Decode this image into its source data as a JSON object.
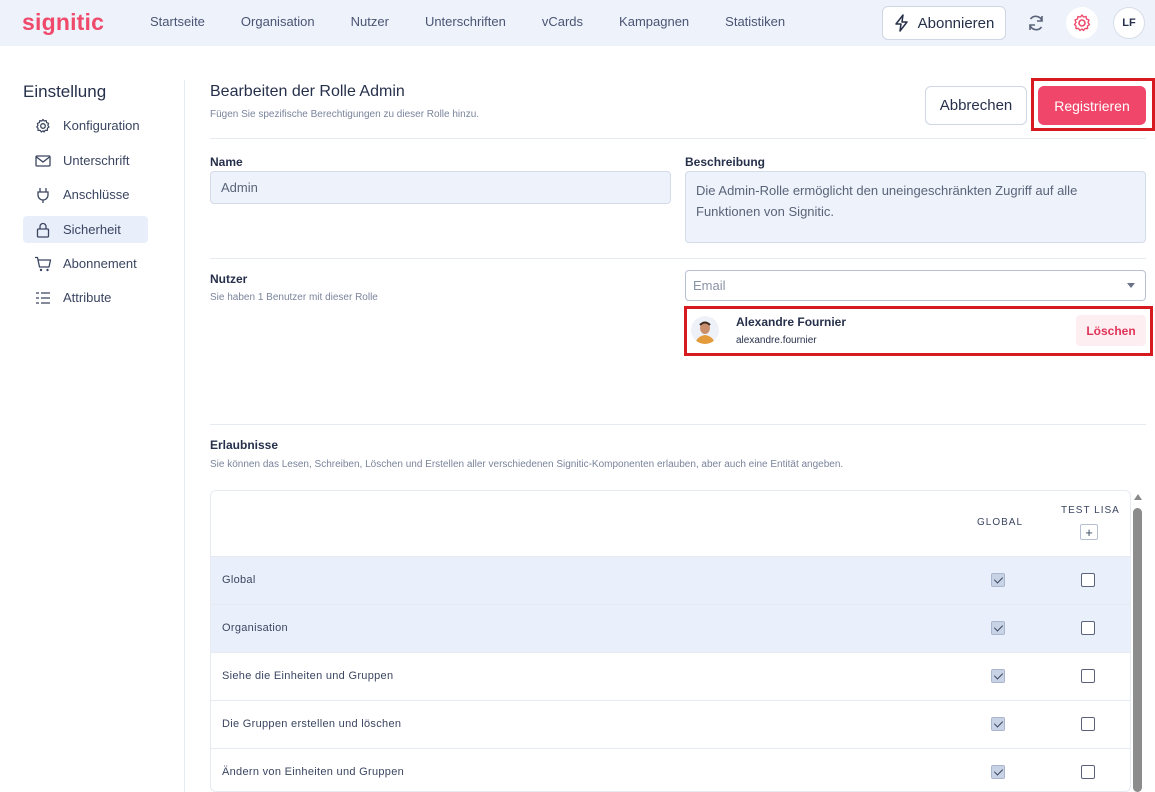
{
  "topbar": {
    "logo": "signitic",
    "nav": [
      "Startseite",
      "Organisation",
      "Nutzer",
      "Unterschriften",
      "vCards",
      "Kampagnen",
      "Statistiken"
    ],
    "subscribe_label": "Abonnieren",
    "avatar_initials": "LF"
  },
  "sidebar": {
    "title": "Einstellung",
    "items": [
      {
        "label": "Konfiguration",
        "icon": "gear-icon"
      },
      {
        "label": "Unterschrift",
        "icon": "mail-icon"
      },
      {
        "label": "Anschlüsse",
        "icon": "plug-icon"
      },
      {
        "label": "Sicherheit",
        "icon": "lock-icon",
        "active": true
      },
      {
        "label": "Abonnement",
        "icon": "cart-icon"
      },
      {
        "label": "Attribute",
        "icon": "list-icon"
      }
    ]
  },
  "header": {
    "title": "Bearbeiten der Rolle Admin",
    "subtitle": "Fügen Sie spezifische Berechtigungen zu dieser Rolle hinzu.",
    "cancel_label": "Abbrechen",
    "register_label": "Registrieren"
  },
  "form": {
    "name_label": "Name",
    "name_value": "Admin",
    "description_label": "Beschreibung",
    "description_value": "Die Admin-Rolle ermöglicht den uneingeschränkten Zugriff auf alle Funktionen von Signitic."
  },
  "users": {
    "label": "Nutzer",
    "note": "Sie haben 1 Benutzer mit dieser Rolle",
    "email_placeholder": "Email",
    "list": [
      {
        "name": "Alexandre Fournier",
        "email": "alexandre.fournier",
        "delete_label": "Löschen"
      }
    ]
  },
  "permissions": {
    "label": "Erlaubnisse",
    "note": "Sie können das Lesen, Schreiben, Löschen und Erstellen aller verschiedenen Signitic-Komponenten erlauben, aber auch eine Entität angeben.",
    "col_global": "GLOBAL",
    "col_test": "TEST LISA",
    "col_add": "+",
    "rows": [
      {
        "label": "Global",
        "group": true,
        "global": true,
        "test": false
      },
      {
        "label": "Organisation",
        "group": true,
        "global": true,
        "test": false
      },
      {
        "label": "Siehe die Einheiten und Gruppen",
        "group": false,
        "global": true,
        "test": false
      },
      {
        "label": "Die Gruppen erstellen und löschen",
        "group": false,
        "global": true,
        "test": false
      },
      {
        "label": "Ändern von Einheiten und Gruppen",
        "group": false,
        "global": true,
        "test": false
      }
    ]
  },
  "colors": {
    "brand": "#ef4a6b",
    "register_bg": "#f0466a",
    "highlight": "#d71920"
  }
}
